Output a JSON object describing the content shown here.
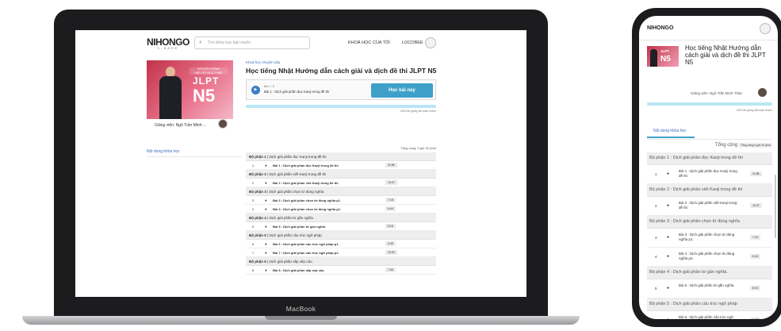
{
  "laptop": {
    "brand_label": "MacBook",
    "nav": {
      "logo": "NIHONGO",
      "logo_sub": "C-BASE",
      "search_placeholder": "Tìm khóa học bạn muốn",
      "link_my_courses": "KHOÁ HỌC CỦA TÔI",
      "user_name": "LOCOBEE"
    },
    "banner": {
      "tag": "CHỈ VỚI 5 TIẾNG\nHIỂU RÕ NGỮ PHÁP",
      "jlpt": "JLPT",
      "level": "N5"
    },
    "teacher_label": "Giảng viên: Ngô Trần Minh ...",
    "course": {
      "category": "Khoá học chuyên sâu",
      "title": "Học tiếng Nhật Hướng dẫn cách giải và dịch đề thi JLPT N5",
      "lesson_small": "Bài 1 / 8",
      "lesson_name": "Bài 1 : Dịch giải phần đọc Kanji trong đề thi",
      "learn_button": "Học bài này",
      "progress_text": "0/25 bài giảng đã hoàn thành",
      "progress": 0
    },
    "content_tab": "Nội dung khóa học",
    "total": "Tổng cộng: 5 giờ 32 phút",
    "curriculum": [
      {
        "type": "section",
        "title": "Bộ phận 1",
        "desc": "Dịch giải phần đọc Kanji trong đề thi"
      },
      {
        "type": "lesson",
        "num": "1",
        "name": "Bài 1 : Dịch giải phần đọc Kanji trong đề thi",
        "dur": "11:58"
      },
      {
        "type": "section",
        "title": "Bộ phận 2",
        "desc": "Dịch giải phần viết Kanji trong đề thi"
      },
      {
        "type": "lesson",
        "num": "2",
        "name": "Bài 2 : Dịch giải phần viết Kanji trong đề thi",
        "dur": "10:37"
      },
      {
        "type": "section",
        "title": "Bộ phận 3",
        "desc": "Dịch giải phần chọn từ đúng nghĩa"
      },
      {
        "type": "lesson",
        "num": "3",
        "name": "Bài 3 : Dịch giải phần chọn từ đúng nghĩa p1.",
        "dur": "7:18"
      },
      {
        "type": "lesson",
        "num": "4",
        "name": "Bài 4 : Dịch giải phần chọn từ đúng nghĩa p2.",
        "dur": "6:44"
      },
      {
        "type": "section",
        "title": "Bộ phận 4",
        "desc": "Dịch giải phần từ gần nghĩa."
      },
      {
        "type": "lesson",
        "num": "5",
        "name": "Bài 5 : Dịch giải phần từ gần nghĩa.",
        "dur": "8:15"
      },
      {
        "type": "section",
        "title": "Bộ phận 5",
        "desc": "Dịch giải phần cấu trúc ngữ pháp"
      },
      {
        "type": "lesson",
        "num": "6",
        "name": "Bài 6 : Dịch giải phần cấu trúc ngữ pháp p1.",
        "dur": "9:45"
      },
      {
        "type": "lesson",
        "num": "7",
        "name": "Bài 7 : Dịch giải phần cấu trúc ngữ pháp p2.",
        "dur": "10:30"
      },
      {
        "type": "section",
        "title": "Bộ phận 6",
        "desc": "Dịch giải phần sắp xếp câu."
      },
      {
        "type": "lesson",
        "num": "8",
        "name": "Bài 8 : Dịch giải phần sắp xếp câu.",
        "dur": "7:46"
      }
    ]
  },
  "phone": {
    "logo": "NIHONGO",
    "banner": {
      "jlpt": "JLPT",
      "level": "N5"
    },
    "title": "Học tiếng Nhật Hướng dẫn cách giải và dịch đề thi JLPT N5",
    "teacher_label": "Giảng viên: Ngô Trần Minh Thảo",
    "progress_text": "0/25 bài giảng đã hoàn thành",
    "progress": 0,
    "content_tab": "Nội dung khóa học",
    "total_label": "Tổng cộng",
    "total_value": "Tổng cộng 5 giờ 32 phút",
    "curriculum": [
      {
        "type": "section",
        "title": "Bộ phận 1 : Dịch giải phần đọc Kanji trong đề thi"
      },
      {
        "type": "lesson",
        "num": "1",
        "name": "Bài 1 : Dịch giải phần đọc Kanji trong đề thi",
        "dur": "11:58"
      },
      {
        "type": "section",
        "title": "Bộ phận 2 : Dịch giải phần viết Kanji trong đề thi"
      },
      {
        "type": "lesson",
        "num": "2",
        "name": "Bài 2 : Dịch giải phần viết Kanji trong đề thi",
        "dur": "10:37"
      },
      {
        "type": "section",
        "title": "Bộ phận 3 : Dịch giải phần chọn từ đúng nghĩa"
      },
      {
        "type": "lesson",
        "num": "3",
        "name": "Bài 3 : Dịch giải phần chọn từ đúng nghĩa p1.",
        "dur": "7:18"
      },
      {
        "type": "lesson",
        "num": "4",
        "name": "Bài 4 : Dịch giải phần chọn từ đúng nghĩa p2.",
        "dur": "6:44"
      },
      {
        "type": "section",
        "title": "Bộ phận 4 : Dịch giải phần từ gần nghĩa."
      },
      {
        "type": "lesson",
        "num": "5",
        "name": "Bài 5 : Dịch giải phần từ gần nghĩa.",
        "dur": "8:15"
      },
      {
        "type": "section",
        "title": "Bộ phận 5 : Dịch giải phần cấu trúc ngữ pháp"
      },
      {
        "type": "lesson",
        "num": "6",
        "name": "Bài 6 : Dịch giải phần cấu trúc ngữ pháp p1.",
        "dur": "9:45"
      }
    ]
  },
  "colors": {
    "accent": "#3ea0c9",
    "link": "#3a6bbf",
    "progress_track": "#b9e6f4",
    "device_frame": "#1c1c1e"
  }
}
